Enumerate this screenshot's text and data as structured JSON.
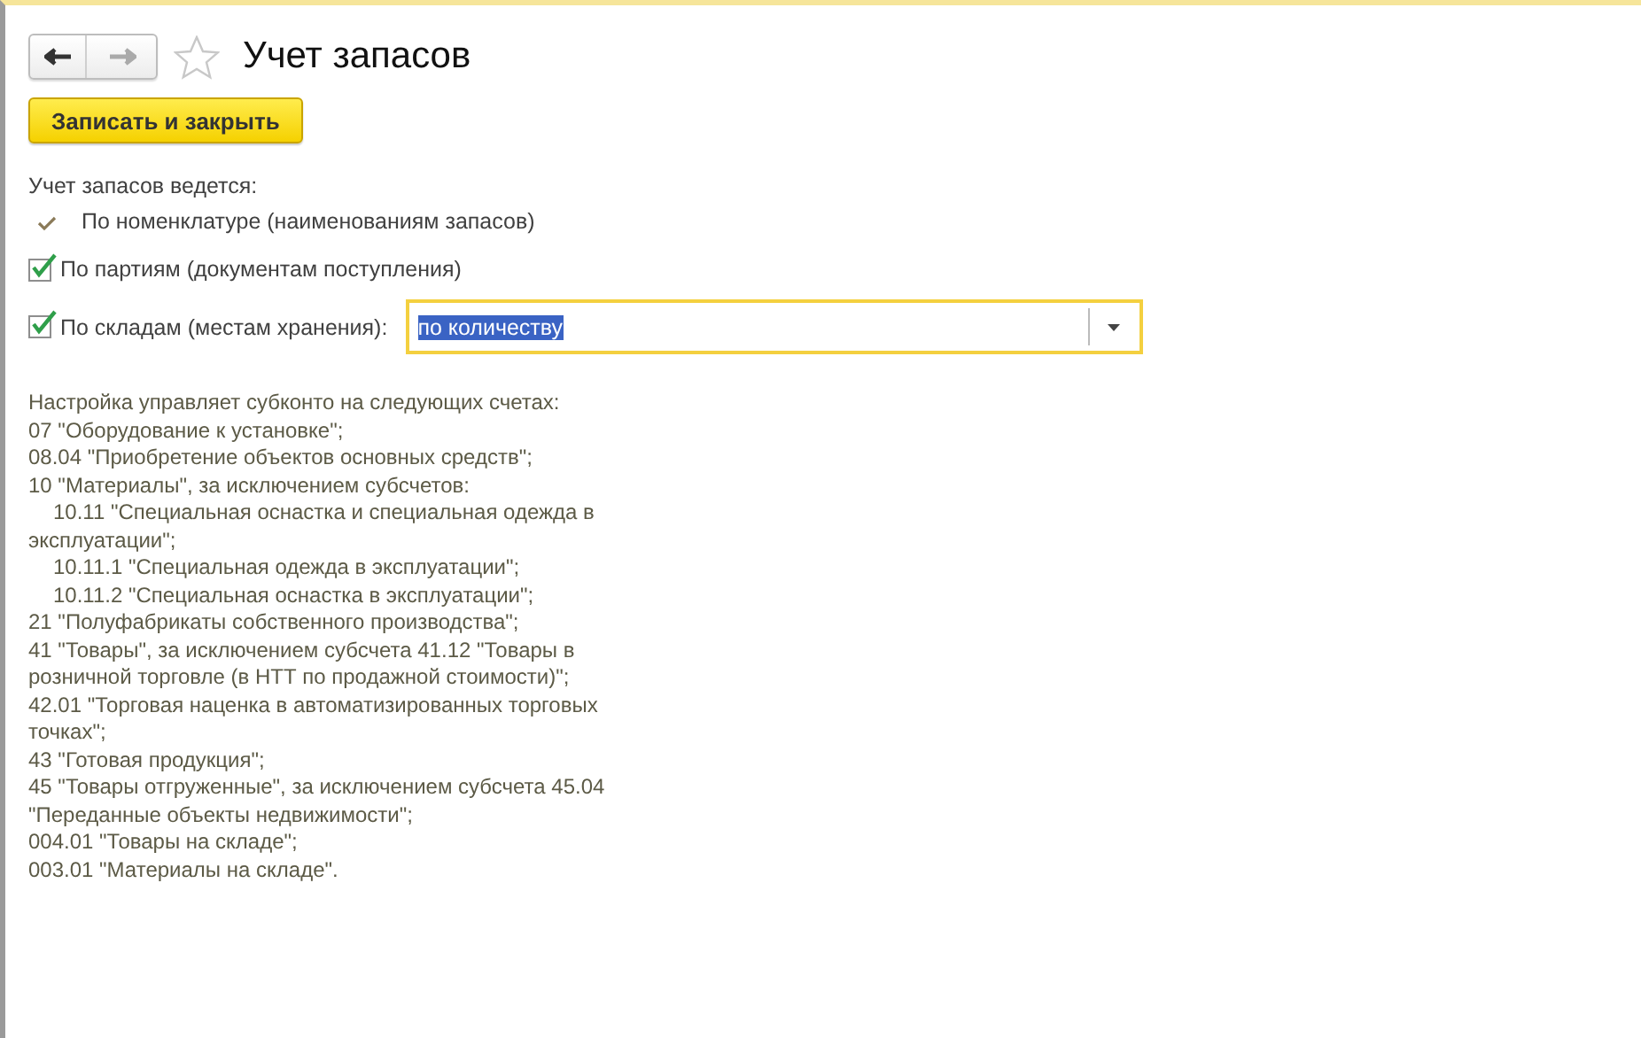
{
  "window": {
    "title": "Учет запасов",
    "favorite": false
  },
  "toolbar": {
    "save_button": "Записать и закрыть"
  },
  "section_label": "Учет запасов ведется:",
  "options": [
    {
      "label": "По номенклатуре (наименованиям запасов)",
      "checked": true,
      "disabled": true
    },
    {
      "label": "По партиям (документам поступления)",
      "checked": true,
      "disabled": false
    },
    {
      "label": "По складам (местам хранения):",
      "checked": true,
      "disabled": false,
      "field": {
        "value": "по количеству",
        "highlighted": true
      }
    }
  ],
  "note_lines": [
    {
      "kind": "plain",
      "text": "Настройка управляет субконто на следующих счетах:"
    },
    {
      "kind": "plain",
      "text": "07 \"Оборудование к установке\";"
    },
    {
      "kind": "plain",
      "text": "08.04 \"Приобретение объектов основных средств\";"
    },
    {
      "kind": "plain",
      "text": "10 \"Материалы\", за исключением субсчетов:"
    },
    {
      "kind": "indented",
      "text": "10.11 \"Специальная оснастка и специальная одежда в"
    },
    {
      "kind": "plain",
      "text": "эксплуатации\";"
    },
    {
      "kind": "indented",
      "text": "10.11.1 \"Специальная одежда в эксплуатации\";"
    },
    {
      "kind": "indented",
      "text": "10.11.2 \"Специальная оснастка в эксплуатации\";"
    },
    {
      "kind": "plain",
      "text": "21 \"Полуфабрикаты собственного производства\";"
    },
    {
      "kind": "plain",
      "text": "41 \"Товары\", за исключением субсчета 41.12 \"Товары в"
    },
    {
      "kind": "plain",
      "text": "розничной торговле (в НТТ по продажной стоимости)\";"
    },
    {
      "kind": "plain",
      "text": "42.01 \"Торговая наценка в автоматизированных торговых"
    },
    {
      "kind": "plain",
      "text": "точках\";"
    },
    {
      "kind": "plain",
      "text": "43 \"Готовая продукция\";"
    },
    {
      "kind": "plain",
      "text": "45 \"Товары отгруженные\", за исключением субсчета 45.04"
    },
    {
      "kind": "plain",
      "text": "\"Переданные объекты недвижимости\";"
    },
    {
      "kind": "plain",
      "text": "004.01 \"Товары на складе\";"
    },
    {
      "kind": "plain",
      "text": "003.01 \"Материалы на складе\"."
    }
  ]
}
